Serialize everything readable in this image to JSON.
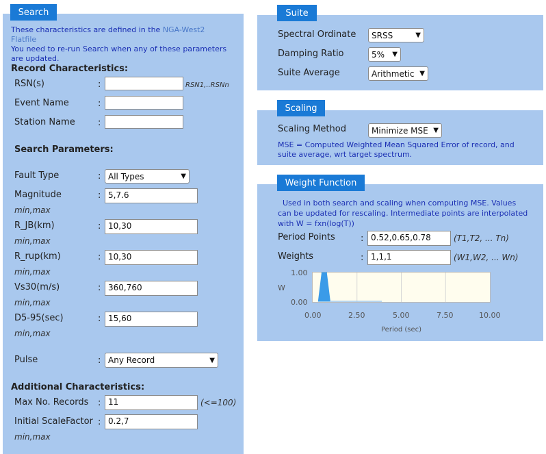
{
  "search": {
    "tab_label": "Search",
    "note_prefix": "These characteristics are defined in the ",
    "note_link": "NGA-West2",
    "note_link2": "Flatfile",
    "note_line3": "You need to re-run Search when any of these parameters",
    "note_line4": "are updated.",
    "record_heading": "Record Characteristics:",
    "rsn_label": "RSN(s)",
    "rsn_value": "",
    "rsn_hint": "RSN1,..RSNn",
    "event_label": "Event Name",
    "event_value": "",
    "station_label": "Station Name",
    "station_value": "",
    "params_heading": "Search Parameters:",
    "fault_label": "Fault Type",
    "fault_value": "All Types",
    "magnitude_label": "Magnitude",
    "magnitude_value": "5,7.6",
    "rjb_label": "R_JB(km)",
    "rjb_value": "10,30",
    "rrup_label": "R_rup(km)",
    "rrup_value": "10,30",
    "vs30_label": "Vs30(m/s)",
    "vs30_value": "360,760",
    "d595_label": "D5-95(sec)",
    "d595_value": "15,60",
    "minmax": "min,max",
    "pulse_label": "Pulse",
    "pulse_value": "Any Record",
    "additional_heading": "Additional Characteristics:",
    "max_records_label": "Max No. Records",
    "max_records_value": "11",
    "max_records_hint": "(<=100)",
    "scale_label": "Initial ScaleFactor",
    "scale_value": "0.2,7",
    "colon": ":"
  },
  "suite": {
    "tab_label": "Suite",
    "ordinate_label": "Spectral Ordinate",
    "ordinate_value": "SRSS",
    "damping_label": "Damping Ratio",
    "damping_value": "5%",
    "average_label": "Suite Average",
    "average_value": "Arithmetic"
  },
  "scaling": {
    "tab_label": "Scaling",
    "method_label": "Scaling Method",
    "method_value": "Minimize MSE",
    "note_line1": "MSE = Computed Weighted Mean Squared Error of record, and",
    "note_line2": "suite average, wrt target spectrum."
  },
  "weight": {
    "tab_label": "Weight Function",
    "note_line1": "Used in both search and scaling when computing MSE. Values",
    "note_line2": "can be updated for rescaling. Intermediate points are interpolated",
    "note_line3": "with W = fxn(log(T))",
    "period_label": "Period Points",
    "period_value": "0.52,0.65,0.78",
    "period_hint": "(T1,T2, ... Tn)",
    "weights_label": "Weights",
    "weights_value": "1,1,1",
    "weights_hint": "(W1,W2, ... Wn)"
  },
  "chart_data": {
    "type": "area",
    "x": [
      0.52,
      0.65,
      0.78
    ],
    "series": [
      {
        "values": [
          1,
          1,
          1
        ]
      }
    ],
    "ylabel": "W",
    "xlabel": "Period (sec)",
    "xlim": [
      0,
      10
    ],
    "ylim": [
      0,
      1
    ],
    "xticks": [
      "0.00",
      "2.50",
      "5.00",
      "7.50",
      "10.00"
    ],
    "yticks": [
      "1.00",
      "0.00"
    ],
    "grid": true,
    "colors": {
      "area": "#3a9be8",
      "plot_bg": "#fffdee"
    }
  }
}
